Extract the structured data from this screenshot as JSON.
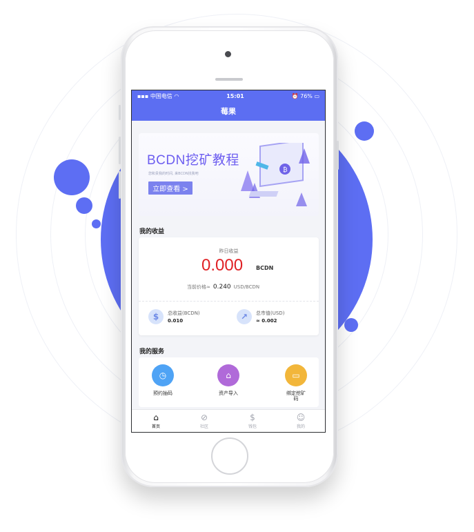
{
  "status_bar": {
    "carrier": "中国电信",
    "time": "15:01",
    "battery": "76%"
  },
  "nav": {
    "title": "莓果"
  },
  "banner": {
    "title": "BCDN挖矿教程",
    "subtitle": "您和贵我的时间, 来BCDN找我吧",
    "button_label": "立即查看 >"
  },
  "earnings": {
    "section_title": "我的收益",
    "caption": "昨日收益",
    "value": "0.000",
    "unit": "BCDN",
    "price_label": "当前价格≈",
    "price_value": "0.240",
    "price_unit": "USD/BCDN",
    "total": {
      "name": "总收益(BCDN)",
      "value": "0.010",
      "icon": "dollar-coin-icon"
    },
    "market": {
      "name": "总市值(USD)",
      "value": "≈ 0.002",
      "icon": "trend-chart-icon"
    }
  },
  "services": {
    "section_title": "我的服务",
    "items": [
      {
        "label": "预约抽码",
        "icon": "clock-icon",
        "color": "#4fa3f5"
      },
      {
        "label": "资产导入",
        "icon": "home-icon",
        "color": "#b06ad9"
      },
      {
        "label": "绑定挖矿码",
        "icon": "card-icon",
        "color": "#f2b63a"
      }
    ]
  },
  "tabs": [
    {
      "label": "首页",
      "icon": "home-icon",
      "active": true
    },
    {
      "label": "社区",
      "icon": "community-icon",
      "active": false
    },
    {
      "label": "钱包",
      "icon": "wallet-icon",
      "active": false
    },
    {
      "label": "我的",
      "icon": "profile-icon",
      "active": false
    }
  ],
  "colors": {
    "brand": "#5c6ef2",
    "accent_red": "#e02125"
  }
}
